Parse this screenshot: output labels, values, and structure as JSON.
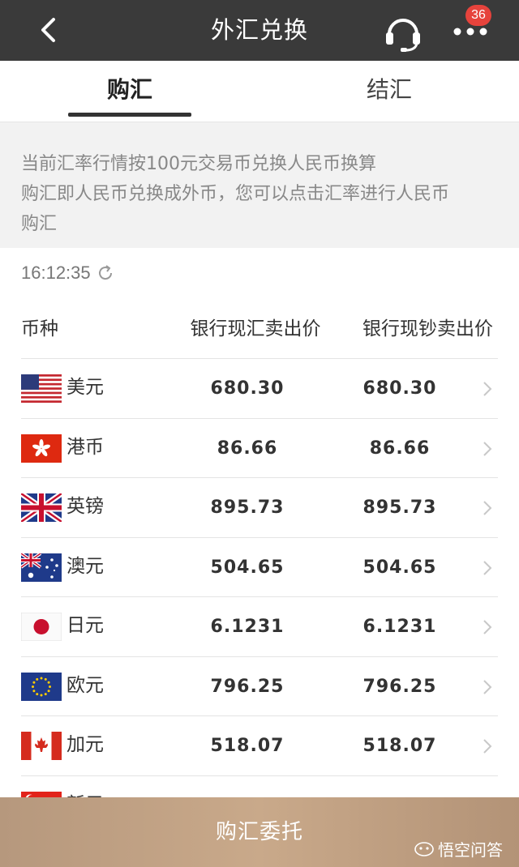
{
  "header": {
    "title": "外汇兑换",
    "back_icon": "chevron-left-icon",
    "service_icon": "headset-icon",
    "more_icon": "more-dots-icon",
    "badge": "36"
  },
  "tabs": [
    {
      "label": "购汇",
      "active": true
    },
    {
      "label": "结汇",
      "active": false
    }
  ],
  "notice": {
    "line1": "当前汇率行情按100元交易币兑换人民币换算",
    "line2": "购汇即人民币兑换成外币，您可以点击汇率进行人民币",
    "line3": "购汇"
  },
  "update_time": "16:12:35",
  "table": {
    "headers": {
      "currency": "币种",
      "transfer_sell": "银行现汇卖出价",
      "cash_sell": "银行现钞卖出价"
    },
    "rows": [
      {
        "flag": "us-flag-icon",
        "name": "美元",
        "transfer": "680.30",
        "cash": "680.30"
      },
      {
        "flag": "hk-flag-icon",
        "name": "港币",
        "transfer": "86.66",
        "cash": "86.66"
      },
      {
        "flag": "uk-flag-icon",
        "name": "英镑",
        "transfer": "895.73",
        "cash": "895.73"
      },
      {
        "flag": "au-flag-icon",
        "name": "澳元",
        "transfer": "504.65",
        "cash": "504.65"
      },
      {
        "flag": "jp-flag-icon",
        "name": "日元",
        "transfer": "6.1231",
        "cash": "6.1231"
      },
      {
        "flag": "eu-flag-icon",
        "name": "欧元",
        "transfer": "796.25",
        "cash": "796.25"
      },
      {
        "flag": "ca-flag-icon",
        "name": "加元",
        "transfer": "518.07",
        "cash": "518.07"
      },
      {
        "flag": "sg-flag-icon",
        "name": "新元",
        "transfer": "",
        "cash": ""
      }
    ]
  },
  "bottom_button": "购汇委托",
  "watermark": "悟空问答",
  "colors": {
    "header_bg": "#3a3a3a",
    "badge": "#e6433c",
    "button_gold": "#c9a98a",
    "notice_bg": "#f2f2f2"
  }
}
